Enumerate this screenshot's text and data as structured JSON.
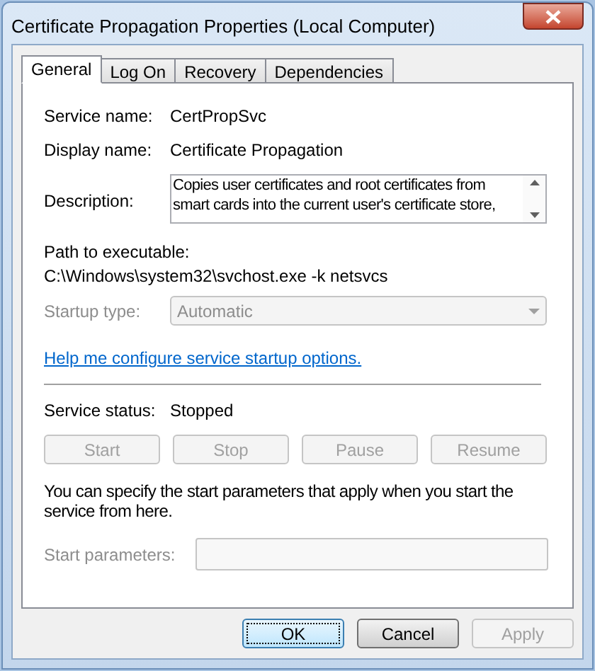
{
  "window": {
    "title": "Certificate Propagation Properties (Local Computer)"
  },
  "tabs": [
    {
      "label": "General",
      "selected": true
    },
    {
      "label": "Log On",
      "selected": false
    },
    {
      "label": "Recovery",
      "selected": false
    },
    {
      "label": "Dependencies",
      "selected": false
    }
  ],
  "service_name": {
    "label": "Service name:",
    "value": "CertPropSvc"
  },
  "display_name": {
    "label": "Display name:",
    "value": "Certificate Propagation"
  },
  "description": {
    "label": "Description:",
    "lines": [
      "Copies user certificates and root certificates from",
      "smart cards into the current user's certificate store,"
    ]
  },
  "path": {
    "label": "Path to executable:",
    "value": "C:\\Windows\\system32\\svchost.exe -k netsvcs"
  },
  "startup_type": {
    "label": "Startup type:",
    "value": "Automatic",
    "disabled": true
  },
  "help_link": "Help me configure service startup options.",
  "service_status": {
    "label": "Service status:",
    "value": "Stopped"
  },
  "service_buttons": [
    {
      "label": "Start",
      "disabled": true
    },
    {
      "label": "Stop",
      "disabled": true
    },
    {
      "label": "Pause",
      "disabled": true
    },
    {
      "label": "Resume",
      "disabled": true
    }
  ],
  "params_note": "You can specify the start parameters that apply when you start the service from here.",
  "start_parameters": {
    "label": "Start parameters:",
    "disabled": true
  },
  "buttons": [
    {
      "label": "OK",
      "disabled": false,
      "default": true
    },
    {
      "label": "Cancel",
      "disabled": false,
      "default": false
    },
    {
      "label": "Apply",
      "disabled": true,
      "default": false
    }
  ]
}
